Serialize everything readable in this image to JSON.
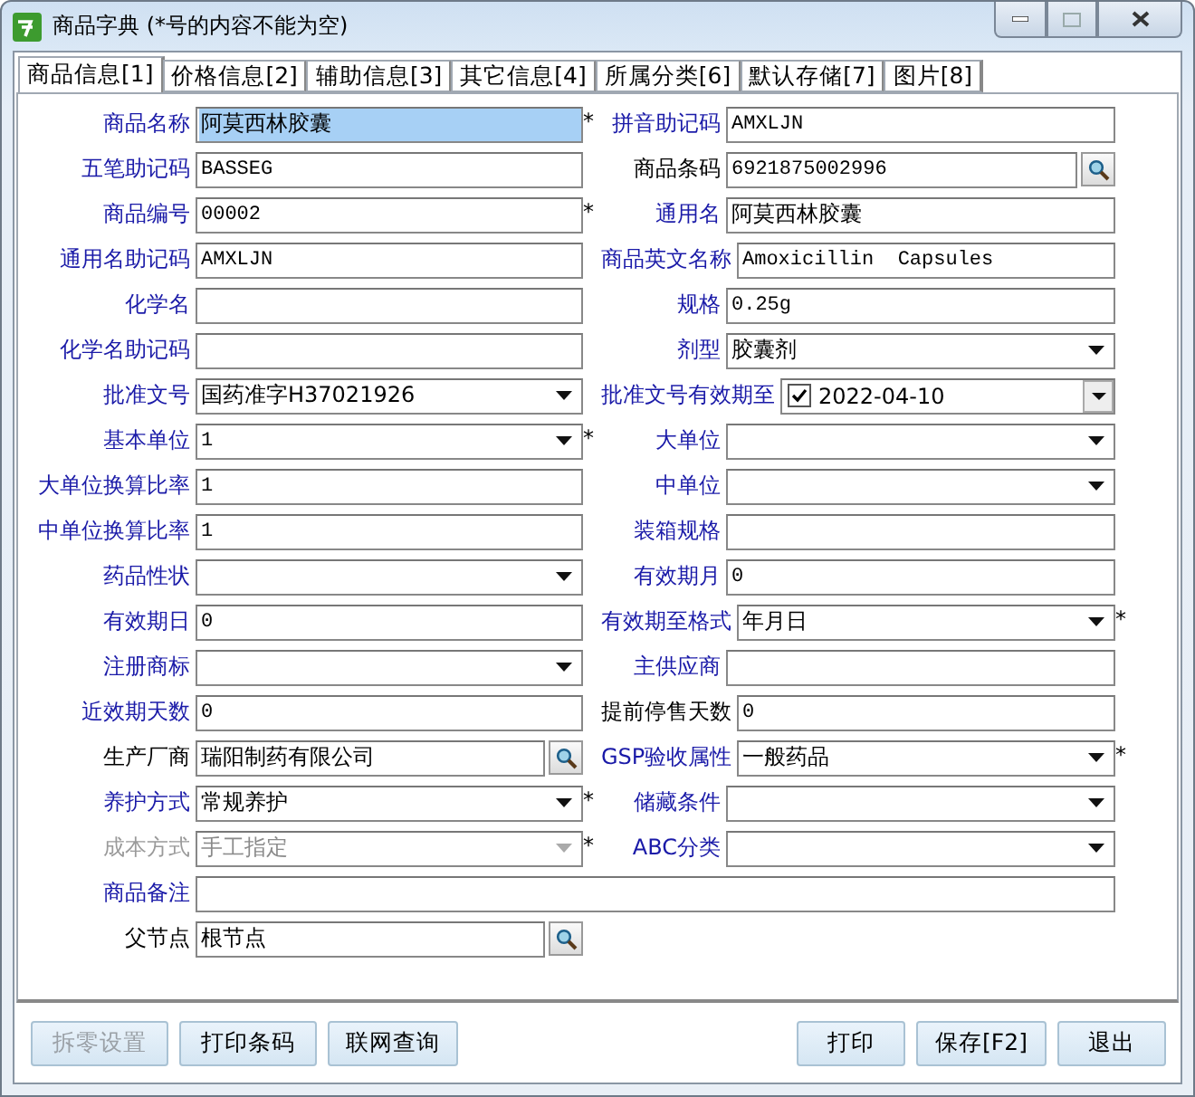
{
  "window": {
    "title": "商品字典 (*号的内容不能为空)"
  },
  "tabs": [
    {
      "label": "商品信息[1]",
      "selected": true
    },
    {
      "label": "价格信息[2]",
      "selected": false
    },
    {
      "label": "辅助信息[3]",
      "selected": false
    },
    {
      "label": "其它信息[4]",
      "selected": false
    },
    {
      "label": "所属分类[6]",
      "selected": false
    },
    {
      "label": "默认存储[7]",
      "selected": false
    },
    {
      "label": "图片[8]",
      "selected": false
    }
  ],
  "rows": [
    {
      "left": {
        "label": "商品名称",
        "color": "#1a1aa8",
        "kind": "text",
        "value": "阿莫西林胶囊",
        "focused": true,
        "mark": "*"
      },
      "right": {
        "label": "拼音助记码",
        "color": "#1a1aa8",
        "kind": "text",
        "value": "AMXLJN"
      }
    },
    {
      "left": {
        "label": "五笔助记码",
        "color": "#1a1aa8",
        "kind": "text",
        "value": "BASSEG"
      },
      "right": {
        "label": "商品条码",
        "color": "#000000",
        "kind": "lookup",
        "value": "6921875002996"
      }
    },
    {
      "left": {
        "label": "商品编号",
        "color": "#1a1aa8",
        "kind": "text",
        "value": "00002",
        "mark": "*"
      },
      "right": {
        "label": "通用名",
        "color": "#1a1aa8",
        "kind": "text",
        "value": "阿莫西林胶囊"
      }
    },
    {
      "left": {
        "label": "通用名助记码",
        "color": "#1a1aa8",
        "kind": "text",
        "value": "AMXLJN"
      },
      "right": {
        "label": "商品英文名称",
        "color": "#1a1aa8",
        "kind": "text",
        "value": "Amoxicillin  Capsules"
      }
    },
    {
      "left": {
        "label": "化学名",
        "color": "#1a1aa8",
        "kind": "text"
      },
      "right": {
        "label": "规格",
        "color": "#1a1aa8",
        "kind": "text",
        "value": "0.25g"
      }
    },
    {
      "left": {
        "label": "化学名助记码",
        "color": "#1a1aa8",
        "kind": "text"
      },
      "right": {
        "label": "剂型",
        "color": "#1a1aa8",
        "kind": "combo",
        "value": "胶囊剂"
      }
    },
    {
      "left": {
        "label": "批准文号",
        "color": "#1a1aa8",
        "kind": "combo",
        "value": "国药准字H37021926"
      },
      "right": {
        "label": "批准文号有效期至",
        "color": "#1a1aa8",
        "kind": "date",
        "value": "2022-04-10",
        "checked": true
      }
    },
    {
      "left": {
        "label": "基本单位",
        "color": "#1a1aa8",
        "kind": "combo",
        "value": "1",
        "mark": "*"
      },
      "right": {
        "label": "大单位",
        "color": "#1a1aa8",
        "kind": "combo"
      }
    },
    {
      "left": {
        "label": "大单位换算比率",
        "color": "#1a1aa8",
        "kind": "text",
        "value": "1"
      },
      "right": {
        "label": "中单位",
        "color": "#1a1aa8",
        "kind": "combo"
      }
    },
    {
      "left": {
        "label": "中单位换算比率",
        "color": "#1a1aa8",
        "kind": "text",
        "value": "1"
      },
      "right": {
        "label": "装箱规格",
        "color": "#1a1aa8",
        "kind": "text"
      }
    },
    {
      "left": {
        "label": "药品性状",
        "color": "#1a1aa8",
        "kind": "combo"
      },
      "right": {
        "label": "有效期月",
        "color": "#1a1aa8",
        "kind": "text",
        "value": "0"
      }
    },
    {
      "left": {
        "label": "有效期日",
        "color": "#1a1aa8",
        "kind": "text",
        "value": "0"
      },
      "right": {
        "label": "有效期至格式",
        "color": "#1a1aa8",
        "kind": "combo",
        "value": "年月日",
        "mark": "*"
      }
    },
    {
      "left": {
        "label": "注册商标",
        "color": "#1a1aa8",
        "kind": "combo"
      },
      "right": {
        "label": "主供应商",
        "color": "#1a1aa8",
        "kind": "text"
      }
    },
    {
      "left": {
        "label": "近效期天数",
        "color": "#1a1aa8",
        "kind": "text",
        "value": "0"
      },
      "right": {
        "label": "提前停售天数",
        "color": "#000000",
        "kind": "text",
        "value": "0"
      }
    },
    {
      "left": {
        "label": "生产厂商",
        "color": "#000000",
        "kind": "lookup",
        "value": "瑞阳制药有限公司"
      },
      "right": {
        "label": "GSP验收属性",
        "color": "#1a1aa8",
        "kind": "combo",
        "value": "一般药品",
        "mark": "*"
      }
    },
    {
      "left": {
        "label": "养护方式",
        "color": "#1a1aa8",
        "kind": "combo",
        "value": "常规养护",
        "mark": "*"
      },
      "right": {
        "label": "储藏条件",
        "color": "#1a1aa8",
        "kind": "combo"
      }
    },
    {
      "left": {
        "label": "成本方式",
        "color": "#9a9a9a",
        "kind": "combo",
        "value": "手工指定",
        "mark": "*",
        "disabled": true
      },
      "right": {
        "label": "ABC分类",
        "color": "#1a1aa8",
        "kind": "combo"
      }
    },
    {
      "left": {
        "label": "商品备注",
        "color": "#1a1aa8",
        "kind": "text",
        "wide": true
      }
    },
    {
      "left": {
        "label": "父节点",
        "color": "#000000",
        "kind": "lookup",
        "value": "根节点"
      }
    }
  ],
  "buttons_left": [
    {
      "label": "拆零设置",
      "disabled": true
    },
    {
      "label": "打印条码",
      "disabled": false
    },
    {
      "label": "联网查询",
      "disabled": false
    }
  ],
  "buttons_right": [
    {
      "label": "打印",
      "disabled": false
    },
    {
      "label": "保存[F2]",
      "disabled": false
    },
    {
      "label": "退出",
      "disabled": false
    }
  ]
}
